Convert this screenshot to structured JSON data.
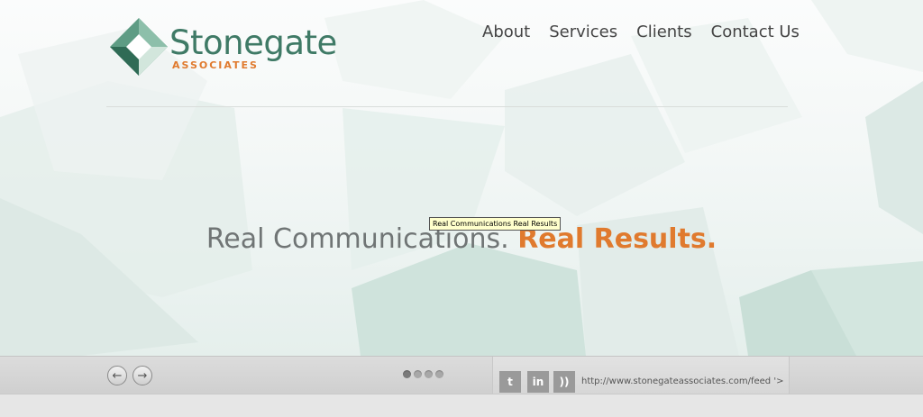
{
  "brand": {
    "name": "Stonegate",
    "sub": "ASSOCIATES",
    "primary_color": "#3f7a66",
    "accent_color": "#e07a2e"
  },
  "nav": {
    "items": [
      {
        "label": "About"
      },
      {
        "label": "Services"
      },
      {
        "label": "Clients"
      },
      {
        "label": "Contact Us"
      }
    ]
  },
  "hero": {
    "tagline_part1": "Real Communications.",
    "tagline_part2": "Real Results.",
    "tooltip": "Real Communications Real Results"
  },
  "footer": {
    "prev_icon": "arrow-left-icon",
    "next_icon": "arrow-right-icon",
    "slide_count": 4,
    "active_slide": 1,
    "social": [
      {
        "name": "twitter-icon",
        "glyph": "t"
      },
      {
        "name": "linkedin-icon",
        "glyph": "in"
      },
      {
        "name": "rss-icon",
        "glyph": "))"
      }
    ],
    "feed_text": "http://www.stonegateassociates.com/feed '>"
  }
}
